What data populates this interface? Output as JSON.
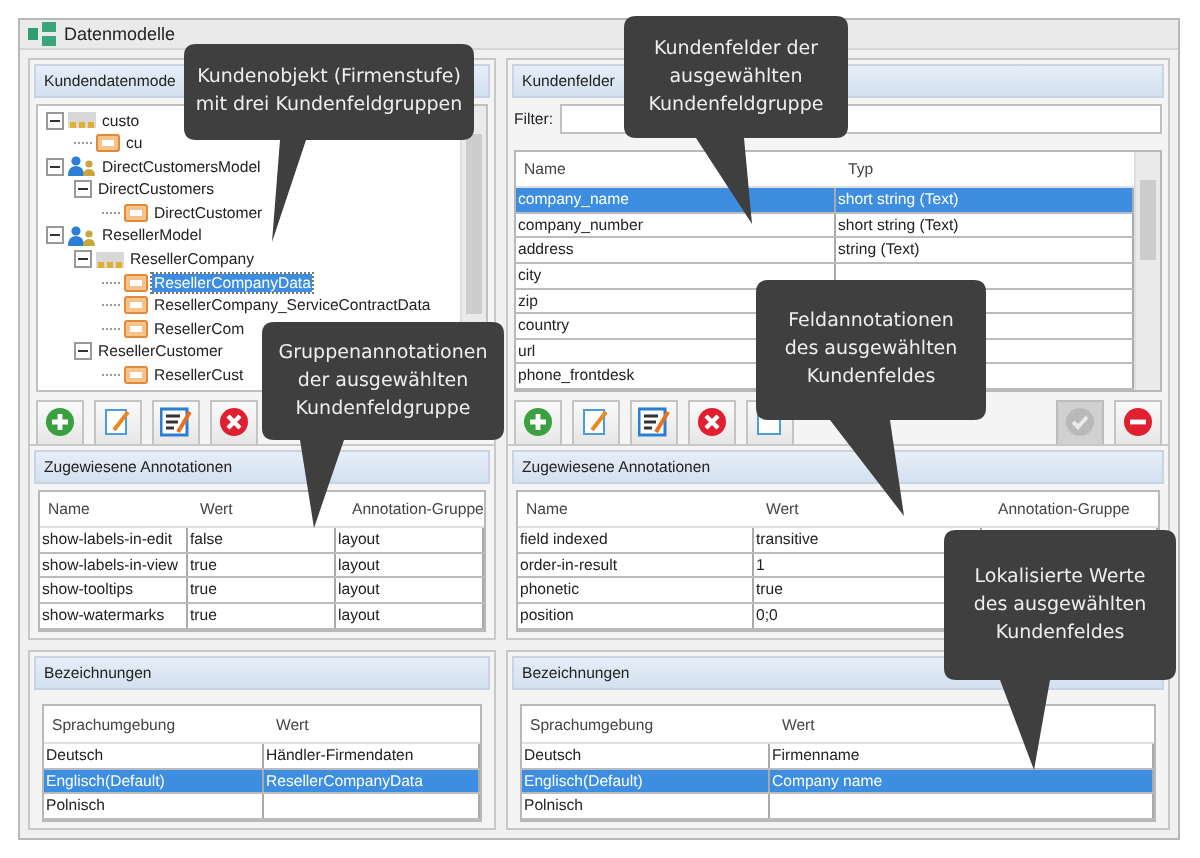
{
  "window": {
    "title": "Datenmodelle"
  },
  "customer_models": {
    "title": "Kundendatenmode",
    "tree": [
      {
        "label": "custo",
        "kind": "entity",
        "selected": false,
        "expanded": true,
        "children": [
          {
            "label": "cu",
            "kind": "group",
            "selected": false
          }
        ]
      },
      {
        "label": "DirectCustomersModel",
        "kind": "model",
        "selected": false,
        "expanded": true,
        "children": [
          {
            "label": "DirectCustomers",
            "kind": "plain",
            "selected": false,
            "expanded": true,
            "children": [
              {
                "label": "DirectCustomer",
                "kind": "group",
                "selected": false
              }
            ]
          }
        ]
      },
      {
        "label": "ResellerModel",
        "kind": "model",
        "selected": false,
        "expanded": true,
        "children": [
          {
            "label": "ResellerCompany",
            "kind": "entity",
            "selected": false,
            "expanded": true,
            "children": [
              {
                "label": "ResellerCompanyData",
                "kind": "group",
                "selected": true
              },
              {
                "label": "ResellerCompany_ServiceContractData",
                "kind": "group",
                "selected": false
              },
              {
                "label": "ResellerCom",
                "kind": "group",
                "selected": false
              }
            ]
          },
          {
            "label": "ResellerCustomer",
            "kind": "plain",
            "selected": false,
            "expanded": true,
            "children": [
              {
                "label": "ResellerCust",
                "kind": "group",
                "selected": false
              }
            ]
          }
        ]
      }
    ],
    "toolbar": [
      {
        "kind": "add",
        "disabled": false
      },
      {
        "kind": "edit",
        "disabled": false
      },
      {
        "kind": "edit-list",
        "disabled": false
      },
      {
        "kind": "delete",
        "disabled": false
      }
    ]
  },
  "customer_fields": {
    "title": "Kundenfelder",
    "filter": {
      "label": "Filter:"
    },
    "table": {
      "columns": [
        "Name",
        "Typ"
      ],
      "rows": [
        {
          "cells": [
            "company_name",
            "short string (Text)"
          ],
          "selected": true
        },
        {
          "cells": [
            "company_number",
            "short string (Text)"
          ],
          "selected": false
        },
        {
          "cells": [
            "address",
            "string (Text)"
          ],
          "selected": false
        },
        {
          "cells": [
            "city"
          ],
          "selected": false
        },
        {
          "cells": [
            "zip"
          ],
          "selected": false
        },
        {
          "cells": [
            "country"
          ],
          "selected": false
        },
        {
          "cells": [
            "url"
          ],
          "selected": false
        },
        {
          "cells": [
            "phone_frontdesk"
          ],
          "selected": false
        }
      ]
    },
    "toolbar": [
      {
        "kind": "add",
        "disabled": false
      },
      {
        "kind": "edit",
        "disabled": false
      },
      {
        "kind": "edit-list",
        "disabled": false
      },
      {
        "kind": "delete",
        "disabled": false
      },
      {
        "kind": "copy",
        "disabled": false
      },
      {
        "kind": "confirm",
        "disabled": true
      },
      {
        "kind": "remove",
        "disabled": false
      }
    ]
  },
  "group_annotations": {
    "title": "Zugewiesene Annotationen",
    "table": {
      "columns": [
        "Name",
        "Wert",
        "Annotation-Gruppe"
      ],
      "rows": [
        {
          "cells": [
            "show-labels-in-edit",
            "false",
            "layout"
          ],
          "selected": false
        },
        {
          "cells": [
            "show-labels-in-view",
            "true",
            "layout"
          ],
          "selected": false
        },
        {
          "cells": [
            "show-tooltips",
            "true",
            "layout"
          ],
          "selected": false
        },
        {
          "cells": [
            "show-watermarks",
            "true",
            "layout"
          ],
          "selected": false
        }
      ]
    }
  },
  "field_annotations": {
    "title": "Zugewiesene Annotationen",
    "table": {
      "columns": [
        "Name",
        "Wert",
        "Annotation-Gruppe"
      ],
      "rows": [
        {
          "cells": [
            "field indexed",
            "transitive"
          ],
          "selected": false
        },
        {
          "cells": [
            "order-in-result",
            "1"
          ],
          "selected": false
        },
        {
          "cells": [
            "phonetic",
            "true"
          ],
          "selected": false
        },
        {
          "cells": [
            "position",
            "0;0"
          ],
          "selected": false
        }
      ]
    }
  },
  "group_labels": {
    "title": "Bezeichnungen",
    "table": {
      "columns": [
        "Sprachumgebung",
        "Wert"
      ],
      "rows": [
        {
          "cells": [
            "Deutsch",
            "Händler-Firmendaten"
          ],
          "selected": false
        },
        {
          "cells": [
            "Englisch(Default)",
            "ResellerCompanyData"
          ],
          "selected": true
        },
        {
          "cells": [
            "Polnisch"
          ],
          "selected": false
        }
      ]
    }
  },
  "field_labels": {
    "title": "Bezeichnungen",
    "table": {
      "columns": [
        "Sprachumgebung",
        "Wert"
      ],
      "rows": [
        {
          "cells": [
            "Deutsch",
            "Firmenname"
          ],
          "selected": false
        },
        {
          "cells": [
            "Englisch(Default)",
            "Company name"
          ],
          "selected": true
        },
        {
          "cells": [
            "Polnisch"
          ],
          "selected": false
        }
      ]
    }
  },
  "callouts": [
    {
      "text": "Kundenobjekt (Firmenstufe)\nmit drei Kundenfeldgruppen"
    },
    {
      "text": "Kundenfelder der\nausgewählten\nKundenfeldgruppe"
    },
    {
      "text": "Gruppenannotationen\nder ausgewählten\nKundenfeldgruppe"
    },
    {
      "text": "Feldannotationen\ndes ausgewählten\nKundenfeldes"
    },
    {
      "text": "Lokalisierte Werte\ndes ausgewählten\nKundenfeldes"
    }
  ]
}
